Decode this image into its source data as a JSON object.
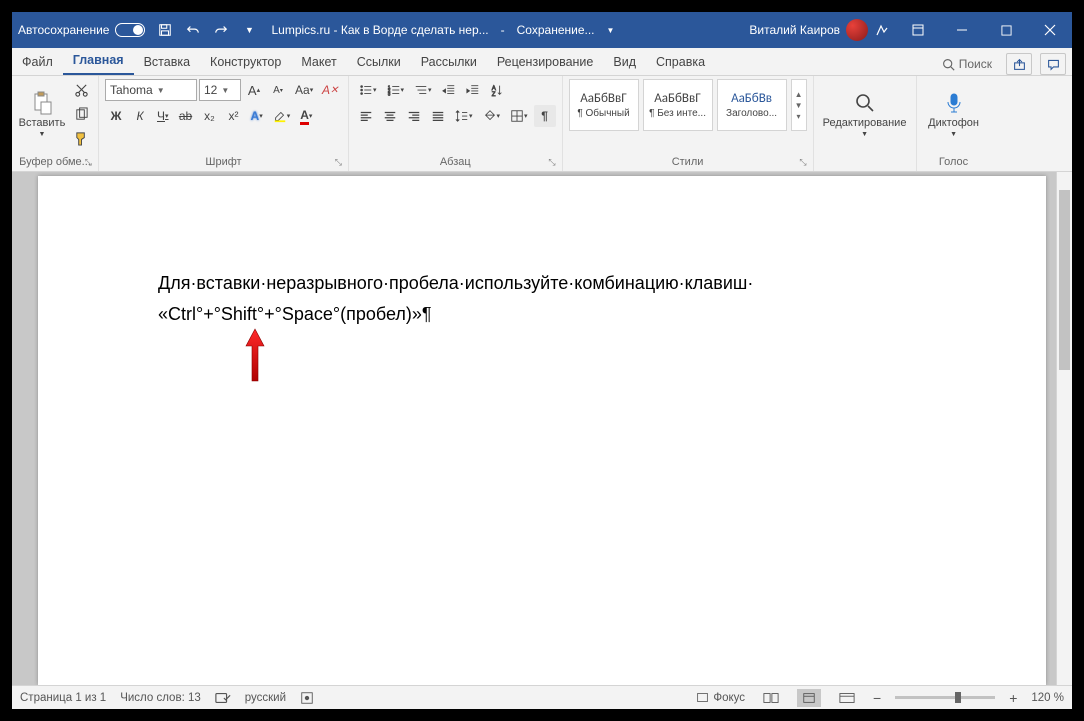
{
  "titlebar": {
    "autosave": "Автосохранение",
    "doc_title": "Lumpics.ru - Как в Ворде сделать нер...",
    "save_status": "Сохранение...",
    "user": "Виталий Каиров"
  },
  "tabs": {
    "file": "Файл",
    "home": "Главная",
    "insert": "Вставка",
    "design": "Конструктор",
    "layout": "Макет",
    "references": "Ссылки",
    "mailings": "Рассылки",
    "review": "Рецензирование",
    "view": "Вид",
    "help": "Справка",
    "search": "Поиск"
  },
  "ribbon": {
    "clipboard": {
      "paste": "Вставить",
      "label": "Буфер обме..."
    },
    "font": {
      "name": "Tahoma",
      "size": "12",
      "label": "Шрифт",
      "bold": "Ж",
      "italic": "К",
      "underline": "Ч",
      "strike": "ab",
      "sub": "x₂",
      "sup": "x²"
    },
    "paragraph": {
      "label": "Абзац"
    },
    "styles": {
      "label": "Стили",
      "s1_sample": "АаБбВвГ",
      "s1_name": "¶ Обычный",
      "s2_sample": "АаБбВвГ",
      "s2_name": "¶ Без инте...",
      "s3_sample": "АаБбВв",
      "s3_name": "Заголово..."
    },
    "editing": {
      "label": "Редактирование"
    },
    "voice": {
      "label": "Голос",
      "btn": "Диктофон"
    }
  },
  "document": {
    "line1": "Для·вставки·неразрывного·пробела·используйте·комбинацию·клавиш·",
    "line2": "«Ctrl°+°Shift°+°Space°(пробел)»¶"
  },
  "statusbar": {
    "page": "Страница 1 из 1",
    "words": "Число слов: 13",
    "lang": "русский",
    "focus": "Фокус",
    "zoom": "120 %"
  }
}
